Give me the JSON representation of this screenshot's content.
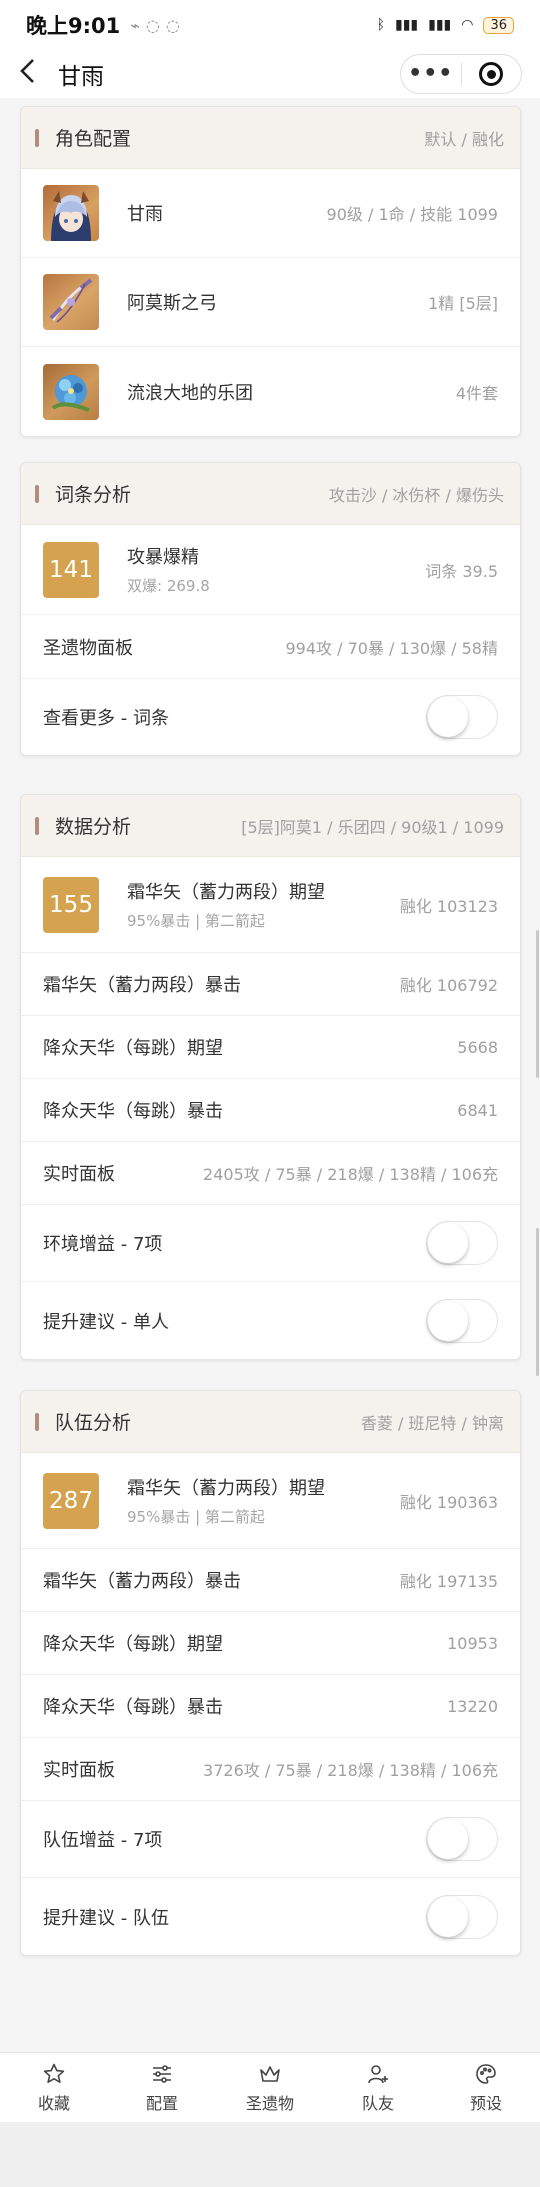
{
  "status_bar": {
    "time": "晚上9:01",
    "battery": "36"
  },
  "nav": {
    "title": "甘雨",
    "back_icon": "chevron-left-icon",
    "more_label": "•••"
  },
  "cards": {
    "role": {
      "title": "角色配置",
      "subtitle": "默认 / 融化",
      "rows": [
        {
          "name": "甘雨",
          "detail": "90级 / 1命 / 技能 1099",
          "icon": "ganyu-portrait"
        },
        {
          "name": "阿莫斯之弓",
          "detail": "1精 [5层]",
          "icon": "amos-bow-icon"
        },
        {
          "name": "流浪大地的乐团",
          "detail": "4件套",
          "icon": "wanderers-troupe-icon"
        }
      ]
    },
    "stats": {
      "title": "词条分析",
      "subtitle": "攻击沙 / 冰伤杯 / 爆伤头",
      "score": "141",
      "score_title": "攻暴爆精",
      "score_sub": "双爆: 269.8",
      "score_value": "词条 39.5",
      "panel_label": "圣遗物面板",
      "panel_value": "994攻 / 70暴 / 130爆 / 58精",
      "more_label": "查看更多 - 词条"
    },
    "data": {
      "title": "数据分析",
      "subtitle": "[5层]阿莫1 / 乐团四 / 90级1 / 1099",
      "score": "155",
      "score_title": "霜华矢（蓄力两段）期望",
      "score_sub": "95%暴击 | 第二箭起",
      "score_value": "融化 103123",
      "rows": [
        {
          "label": "霜华矢（蓄力两段）暴击",
          "value": "融化 106792"
        },
        {
          "label": "降众天华（每跳）期望",
          "value": "5668"
        },
        {
          "label": "降众天华（每跳）暴击",
          "value": "6841"
        },
        {
          "label": "实时面板",
          "value": "2405攻 / 75暴 / 218爆 / 138精 / 106充"
        }
      ],
      "toggle1_label": "环境增益 - 7项",
      "toggle2_label": "提升建议 - 单人"
    },
    "team": {
      "title": "队伍分析",
      "subtitle": "香菱 / 班尼特 / 钟离",
      "score": "287",
      "score_title": "霜华矢（蓄力两段）期望",
      "score_sub": "95%暴击 | 第二箭起",
      "score_value": "融化 190363",
      "rows": [
        {
          "label": "霜华矢（蓄力两段）暴击",
          "value": "融化 197135"
        },
        {
          "label": "降众天华（每跳）期望",
          "value": "10953"
        },
        {
          "label": "降众天华（每跳）暴击",
          "value": "13220"
        },
        {
          "label": "实时面板",
          "value": "3726攻 / 75暴 / 218爆 / 138精 / 106充"
        }
      ],
      "toggle1_label": "队伍增益 - 7项",
      "toggle2_label": "提升建议 - 队伍"
    }
  },
  "tabs": [
    {
      "label": "收藏",
      "icon": "star-icon"
    },
    {
      "label": "配置",
      "icon": "sliders-icon"
    },
    {
      "label": "圣遗物",
      "icon": "crown-icon"
    },
    {
      "label": "队友",
      "icon": "user-plus-icon"
    },
    {
      "label": "预设",
      "icon": "palette-icon"
    }
  ],
  "colors": {
    "accent_bar": "#b08e7a",
    "score_box": "#d5a250",
    "card_head_bg": "#f5f2ee"
  }
}
